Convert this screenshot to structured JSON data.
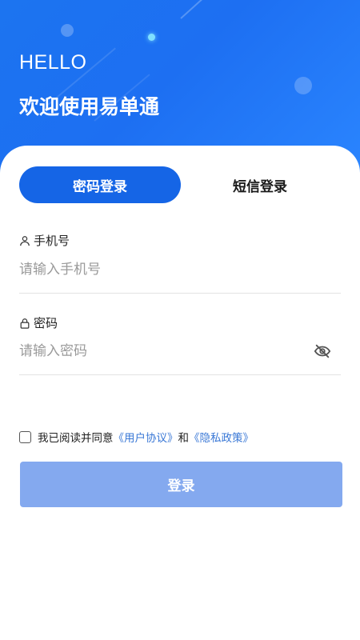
{
  "header": {
    "greeting": "HELLO",
    "welcome": "欢迎使用易单通"
  },
  "tabs": [
    {
      "label": "密码登录",
      "active": true
    },
    {
      "label": "短信登录",
      "active": false
    }
  ],
  "phone": {
    "label": "手机号",
    "placeholder": "请输入手机号",
    "value": ""
  },
  "password": {
    "label": "密码",
    "placeholder": "请输入密码",
    "value": "",
    "visibility_icon": "eye-off-icon"
  },
  "agreement": {
    "prefix": "我已阅读并同意",
    "user_agreement": "《用户协议》",
    "conjunction": "和",
    "privacy_policy": "《隐私政策》",
    "checked": false
  },
  "login_button": {
    "label": "登录"
  },
  "colors": {
    "primary": "#1565e6",
    "hero": "#1c74f0",
    "button_disabled": "#84a9ef",
    "link": "#3a78d6"
  }
}
